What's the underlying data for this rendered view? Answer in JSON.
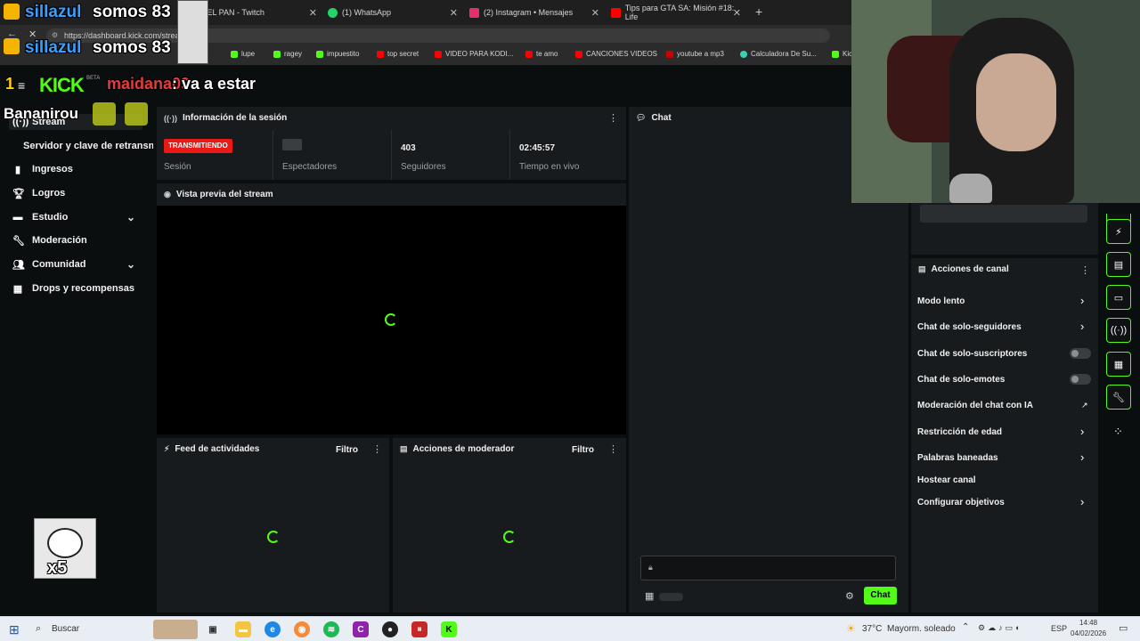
{
  "browser": {
    "tabs": [
      {
        "title": "DEL PAN - Twitch",
        "color": "#9146ff"
      },
      {
        "title": "(1) WhatsApp",
        "color": "#25d366"
      },
      {
        "title": "(2) Instagram • Mensajes",
        "color": "#e1306c"
      },
      {
        "title": "Tips para GTA SA: Misión #18: Life",
        "color": "#ff0000"
      }
    ],
    "url": "https://dashboard.kick.com/stream",
    "bookmarks": [
      {
        "label": "lupe",
        "color": "#53fc18"
      },
      {
        "label": "ragey",
        "color": "#53fc18"
      },
      {
        "label": "impuestito",
        "color": "#53fc18"
      },
      {
        "label": "top secret",
        "color": "#ff0000"
      },
      {
        "label": "VIDEO PARA KODI...",
        "color": "#ff0000"
      },
      {
        "label": "te amo",
        "color": "#ff0000"
      },
      {
        "label": "CANCIONES VIDEOS",
        "color": "#ff0000"
      },
      {
        "label": "youtube a mp3",
        "color": "#cc0000"
      },
      {
        "label": "Calculadora De Su...",
        "color": "#3ad1b3"
      },
      {
        "label": "Kic",
        "color": "#53fc18"
      }
    ]
  },
  "overlay": {
    "brand_1": "sillazul",
    "count_text_1": "somos 83",
    "brand_2": "sillazul",
    "count_text_2": "somos 83",
    "chat_user": "maidana09",
    "chat_msg": ": va a estar",
    "user2": "Bananirou",
    "beta": "BETA",
    "x5": "x5"
  },
  "sidebar": {
    "items": [
      {
        "label": "Stream",
        "icon": "broadcast-icon"
      },
      {
        "label": "Servidor y clave de retransmisión",
        "icon": ""
      },
      {
        "label": "Ingresos",
        "icon": "chart-icon"
      },
      {
        "label": "Logros",
        "icon": "trophy-icon"
      },
      {
        "label": "Estudio",
        "icon": "studio-icon"
      },
      {
        "label": "Moderación",
        "icon": "wrench-icon"
      },
      {
        "label": "Comunidad",
        "icon": "users-icon"
      },
      {
        "label": "Drops y recompensas",
        "icon": "gift-icon"
      }
    ]
  },
  "session": {
    "title": "Información de la sesión",
    "status_badge": "TRANSMITIENDO",
    "status_label": "Sesión",
    "viewers_label": "Espectadores",
    "followers_value": "403",
    "followers_label": "Seguidores",
    "live_time_value": "02:45:57",
    "live_time_label": "Tiempo en vivo"
  },
  "preview": {
    "title": "Vista previa del stream"
  },
  "activity": {
    "title": "Feed de actividades",
    "filter": "Filtro"
  },
  "modactions": {
    "title": "Acciones de moderador",
    "filter": "Filtro"
  },
  "chat": {
    "title": "Chat",
    "send_label": "Chat"
  },
  "channel_actions": {
    "title": "Acciones de canal",
    "items": [
      {
        "label": "Modo lento",
        "kind": "arrow"
      },
      {
        "label": "Chat de solo-seguidores",
        "kind": "arrow"
      },
      {
        "label": "Chat de solo-suscriptores",
        "kind": "toggle"
      },
      {
        "label": "Chat de solo-emotes",
        "kind": "toggle"
      },
      {
        "label": "Moderación del chat con IA",
        "kind": "external"
      },
      {
        "label": "Restricción de edad",
        "kind": "arrow"
      },
      {
        "label": "Palabras baneadas",
        "kind": "arrow"
      },
      {
        "label": "Hostear canal",
        "kind": "none"
      },
      {
        "label": "Configurar objetivos",
        "kind": "arrow"
      }
    ]
  },
  "taskbar": {
    "search_label": "Buscar",
    "weather": "37°C",
    "weather_desc": "Mayorm. soleado",
    "lang": "ESP",
    "time": "14:48",
    "date": "04/02/2026"
  },
  "colors": {
    "accent": "#53fc18",
    "live": "#e91916"
  }
}
